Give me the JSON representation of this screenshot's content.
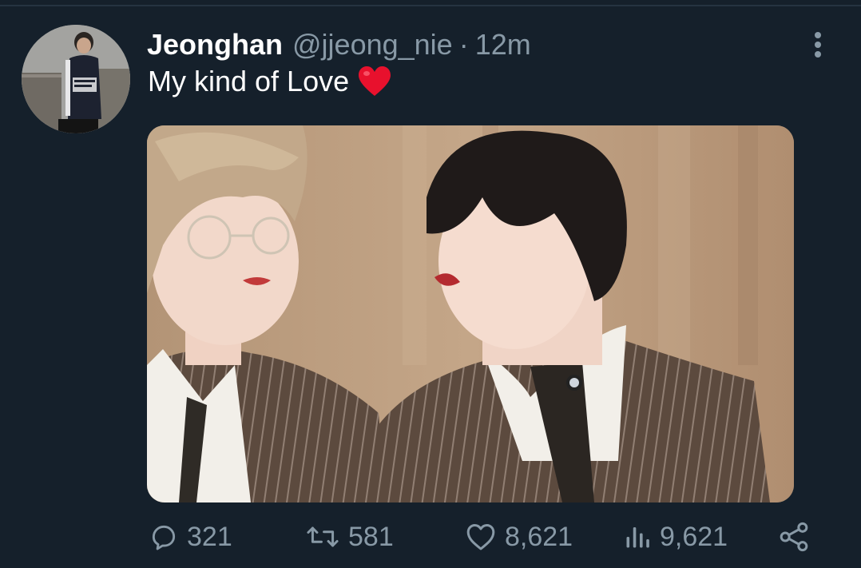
{
  "tweet": {
    "display_name": "Jeonghan",
    "handle": "@jjeong_nie",
    "separator": "·",
    "time": "12m",
    "text": "My kind of Love"
  },
  "actions": {
    "reply_count": "321",
    "retweet_count": "581",
    "like_count": "8,621",
    "view_count": "9,621"
  },
  "icons": {
    "more": "more-vertical-icon",
    "heart_emoji": "red-heart-emoji",
    "reply": "reply-icon",
    "retweet": "retweet-icon",
    "like": "like-icon",
    "views": "views-icon",
    "share": "share-icon"
  },
  "colors": {
    "background": "#15202b",
    "text_primary": "#ffffff",
    "text_secondary": "#8899a6",
    "emoji_red": "#e8112d"
  }
}
